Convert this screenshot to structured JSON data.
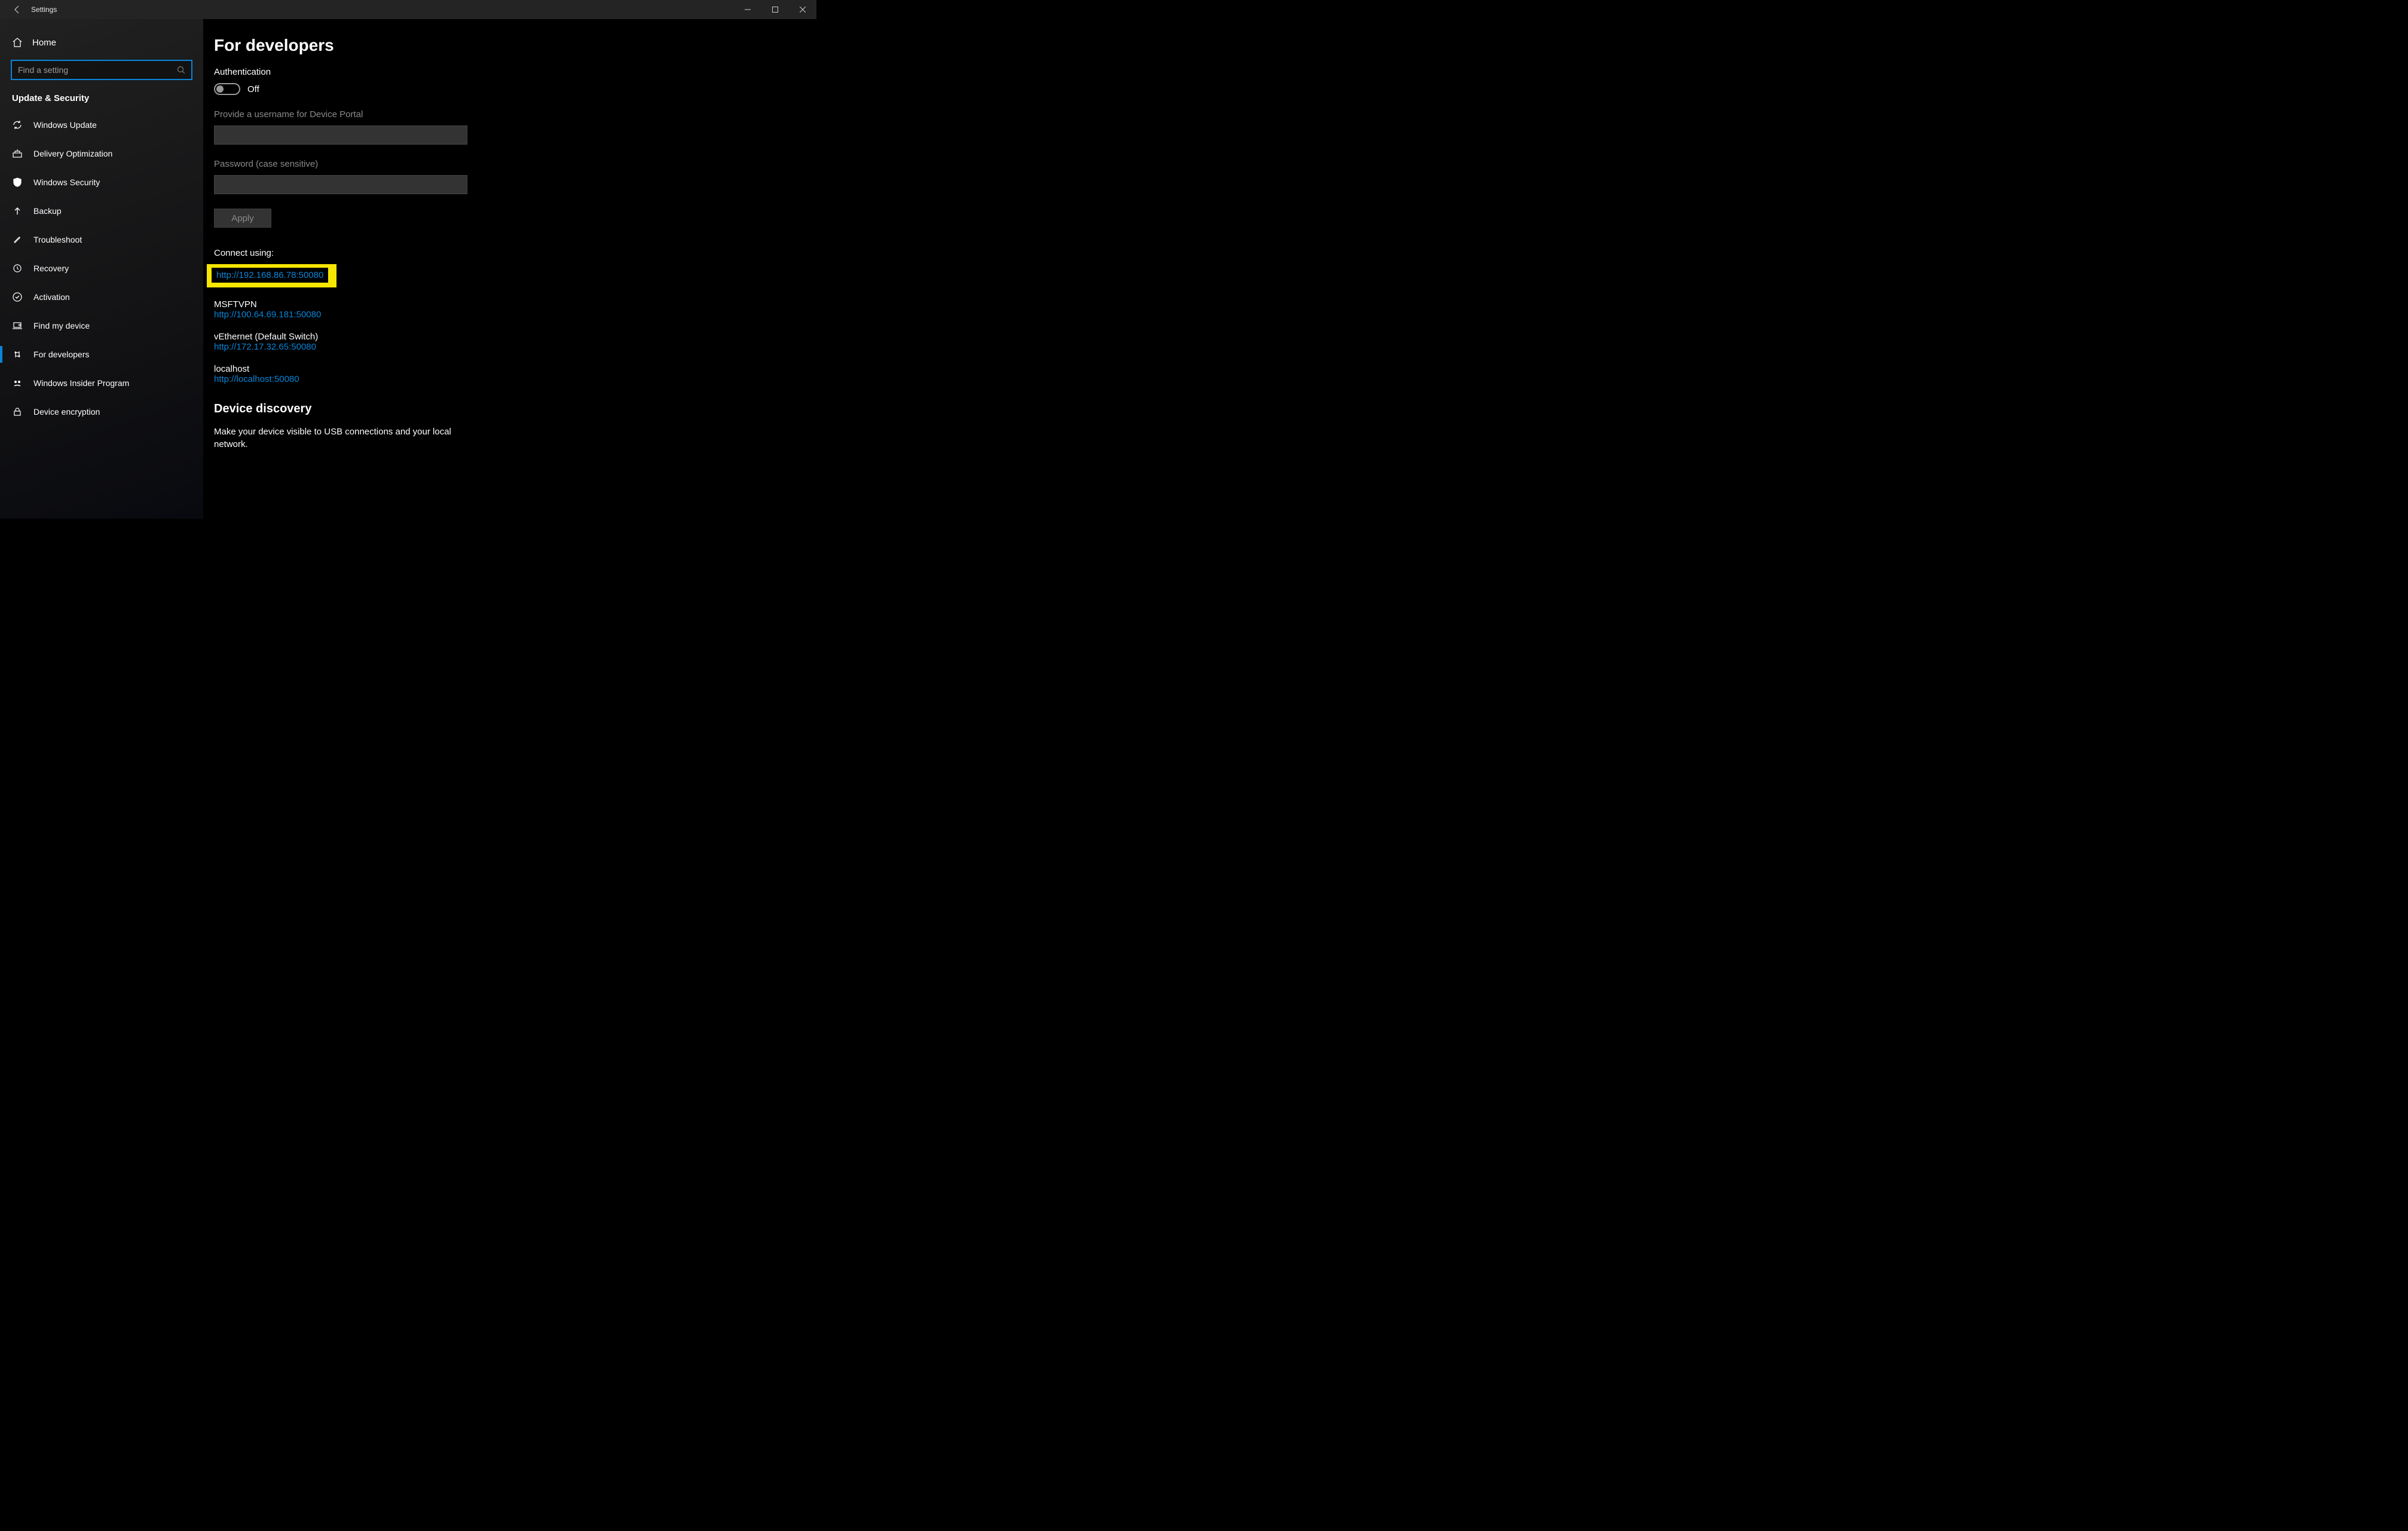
{
  "window": {
    "title": "Settings"
  },
  "sidebar": {
    "home_label": "Home",
    "search_placeholder": "Find a setting",
    "category": "Update & Security",
    "items": [
      {
        "label": "Windows Update",
        "icon": "sync-icon"
      },
      {
        "label": "Delivery Optimization",
        "icon": "delivery-icon"
      },
      {
        "label": "Windows Security",
        "icon": "shield-icon"
      },
      {
        "label": "Backup",
        "icon": "arrow-up-icon"
      },
      {
        "label": "Troubleshoot",
        "icon": "wrench-icon"
      },
      {
        "label": "Recovery",
        "icon": "recovery-icon"
      },
      {
        "label": "Activation",
        "icon": "check-circle-icon"
      },
      {
        "label": "Find my device",
        "icon": "find-device-icon"
      },
      {
        "label": "For developers",
        "icon": "developers-icon"
      },
      {
        "label": "Windows Insider Program",
        "icon": "insider-icon"
      },
      {
        "label": "Device encryption",
        "icon": "lock-icon"
      }
    ]
  },
  "page": {
    "title": "For developers",
    "auth_heading": "Authentication",
    "toggle_state": "Off",
    "username_label": "Provide a username for Device Portal",
    "password_label": "Password (case sensitive)",
    "apply_label": "Apply",
    "connect_label": "Connect using:",
    "connections": [
      {
        "name": "",
        "url": "http://192.168.86.78:50080",
        "highlighted": true
      },
      {
        "name": "MSFTVPN",
        "url": "http://100.64.69.181:50080"
      },
      {
        "name": "vEthernet (Default Switch)",
        "url": "http://172.17.32.65:50080"
      },
      {
        "name": "localhost",
        "url": "http://localhost:50080"
      }
    ],
    "discovery_heading": "Device discovery",
    "discovery_text": "Make your device visible to USB connections and your local network."
  }
}
